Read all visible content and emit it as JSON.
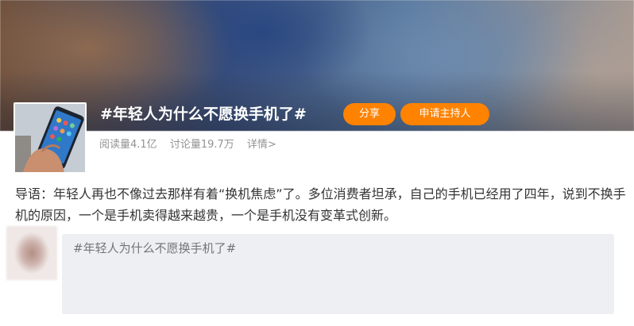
{
  "topic": {
    "title": "#年轻人为什么不愿换手机了#",
    "share_label": "分享",
    "host_label": "申请主持人"
  },
  "stats": {
    "reads": "阅读量4.1亿",
    "discussions": "讨论量19.7万",
    "detail_link": "详情>"
  },
  "intro": {
    "text": "导语：年轻人再也不像过去那样有着“换机焦虑”了。多位消费者坦承，自己的手机已经用了四年，说到不换手机的原因，一个是手机卖得越来越贵，一个是手机没有变革式创新。"
  },
  "composer": {
    "value": "#年轻人为什么不愿换手机了#"
  },
  "colors": {
    "accent": "#ff8200",
    "composer_bg": "#eeeff3",
    "muted_text": "#939393"
  },
  "icons": {
    "cover": "phone-in-hand-image",
    "avatar": "user-avatar-blurred"
  }
}
